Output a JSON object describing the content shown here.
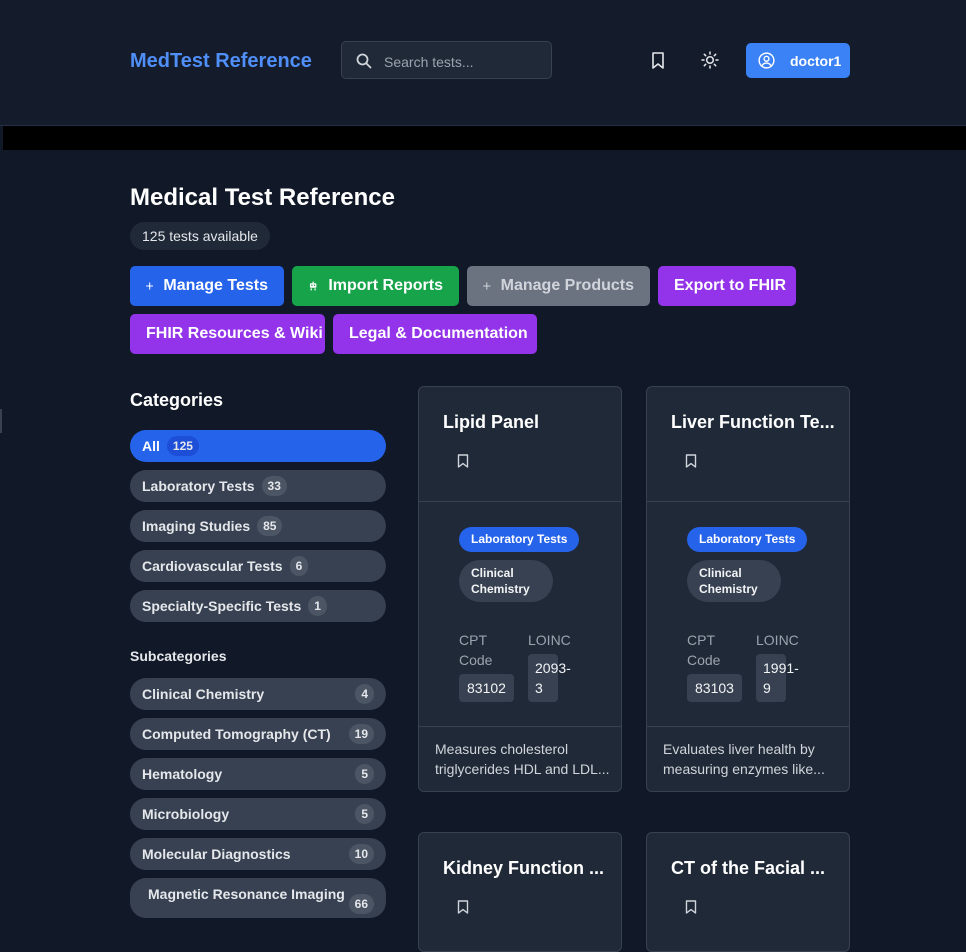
{
  "header": {
    "brand": "MedTest Reference",
    "search_placeholder": "Search tests...",
    "user_label": "doctor1"
  },
  "page": {
    "title": "Medical Test Reference",
    "count_text": "125 tests available"
  },
  "actions": [
    {
      "label": "Manage Tests"
    },
    {
      "label": "Import Reports"
    },
    {
      "label": "Manage Products"
    },
    {
      "label": "Export to FHIR"
    },
    {
      "label": "FHIR Resources & Wiki"
    },
    {
      "label": "Legal & Documentation"
    }
  ],
  "sidebar": {
    "categories_title": "Categories",
    "categories": [
      {
        "label": "All",
        "count": "125"
      },
      {
        "label": "Laboratory Tests",
        "count": "33"
      },
      {
        "label": "Imaging Studies",
        "count": "85"
      },
      {
        "label": "Cardiovascular Tests",
        "count": "6"
      },
      {
        "label": "Specialty-Specific Tests",
        "count": "1"
      }
    ],
    "subcategories_title": "Subcategories",
    "subcategories": [
      {
        "label": "Clinical Chemistry",
        "count": "4"
      },
      {
        "label": "Computed Tomography (CT)",
        "count": "19"
      },
      {
        "label": "Hematology",
        "count": "5"
      },
      {
        "label": "Microbiology",
        "count": "5"
      },
      {
        "label": "Molecular Diagnostics",
        "count": "10"
      },
      {
        "label": "Magnetic Resonance Imaging",
        "count": "66"
      }
    ]
  },
  "cards": [
    {
      "title": "Lipid Panel",
      "category": "Laboratory Tests",
      "subcategory": "Clinical Chemistry",
      "cpt_label": "CPT Code",
      "cpt": "83102",
      "loinc_label": "LOINC",
      "loinc": "2093-3",
      "description": "Measures cholesterol triglycerides HDL and LDL..."
    },
    {
      "title": "Liver Function Te...",
      "category": "Laboratory Tests",
      "subcategory": "Clinical Chemistry",
      "cpt_label": "CPT Code",
      "cpt": "83103",
      "loinc_label": "LOINC",
      "loinc": "1991-9",
      "description": "Evaluates liver health by measuring enzymes like..."
    },
    {
      "title": "Kidney Function ..."
    },
    {
      "title": "CT of the Facial ..."
    }
  ],
  "colors": {
    "background": "#111827",
    "brand": "#4f8ff7",
    "primary": "#2563eb",
    "success": "#16a34a",
    "purple": "#9333ea",
    "muted": "#6b7280"
  }
}
